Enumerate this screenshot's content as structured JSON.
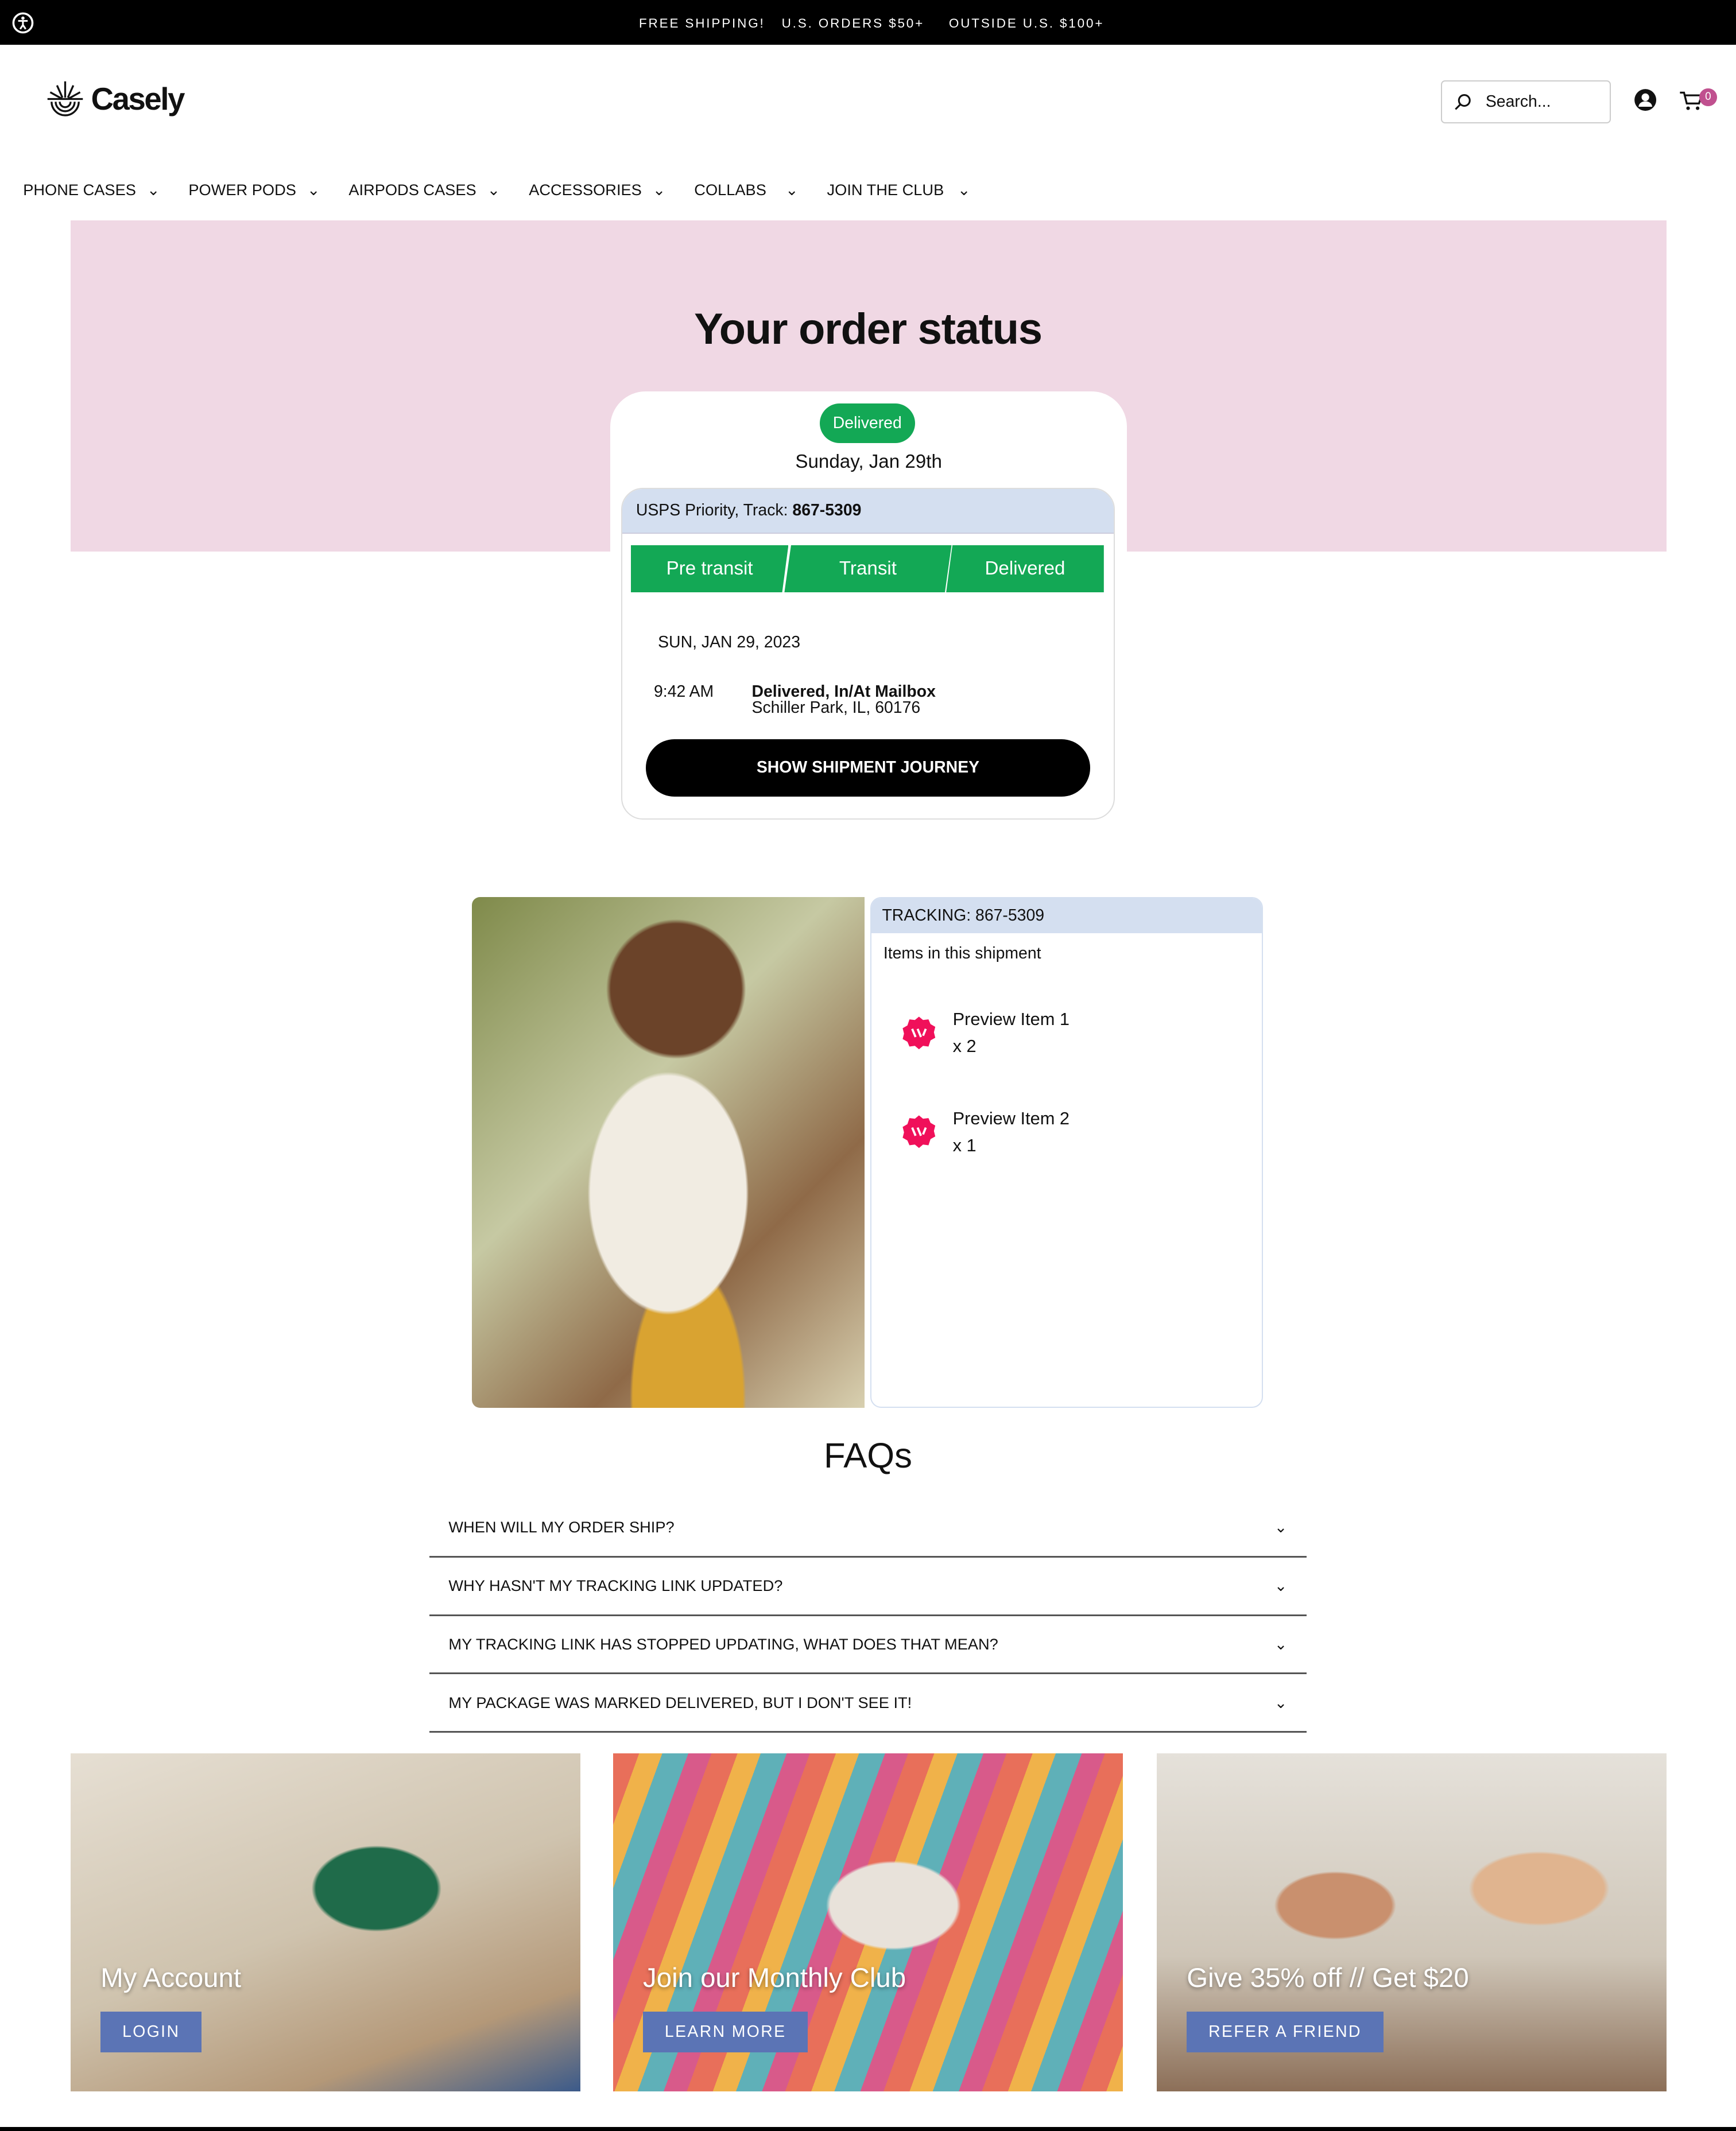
{
  "announcement": {
    "items": [
      "FREE SHIPPING!",
      "U.S. ORDERS $50+",
      "OUTSIDE U.S. $100+"
    ]
  },
  "header": {
    "brand": "Casely",
    "search_placeholder": "Search...",
    "cart_count": "0"
  },
  "nav": [
    {
      "label": "PHONE CASES"
    },
    {
      "label": "POWER PODS"
    },
    {
      "label": "AIRPODS CASES"
    },
    {
      "label": "ACCESSORIES"
    },
    {
      "label": "COLLABS"
    },
    {
      "label": "JOIN THE CLUB"
    }
  ],
  "order": {
    "title": "Your order status",
    "status": "Delivered",
    "date": "Sunday, Jan 29th",
    "carrier_label": "USPS Priority, Track: ",
    "tracking": "867-5309",
    "steps": [
      "Pre transit",
      "Transit",
      "Delivered"
    ],
    "event_date": "SUN, JAN 29, 2023",
    "event_time": "9:42 AM",
    "event_status": "Delivered, In/At Mailbox",
    "event_location": "Schiller Park, IL, 60176",
    "button": "SHOW SHIPMENT JOURNEY"
  },
  "shipment": {
    "header_label": "TRACKING: ",
    "tracking": "867-5309",
    "subtitle": "Items in this shipment",
    "items": [
      {
        "name": "Preview Item 1",
        "qty": "x 2"
      },
      {
        "name": "Preview Item 2",
        "qty": "x 1"
      }
    ]
  },
  "faq": {
    "title": "FAQs",
    "items": [
      "WHEN WILL MY ORDER SHIP?",
      "WHY HASN'T MY TRACKING LINK UPDATED?",
      "MY TRACKING LINK HAS STOPPED UPDATING, WHAT DOES THAT MEAN?",
      "MY PACKAGE WAS MARKED DELIVERED, BUT I DON'T SEE IT!"
    ]
  },
  "tiles": [
    {
      "title": "My Account",
      "button": "LOGIN"
    },
    {
      "title": "Join our Monthly Club",
      "button": "LEARN MORE"
    },
    {
      "title": "Give 35% off // Get $20",
      "button": "REFER A FRIEND"
    }
  ],
  "colors": {
    "green": "#13a855",
    "pink_banner": "#f0d8e4",
    "light_blue": "#d4dff0",
    "tile_button": "#5b74b5",
    "cart_badge": "#c0508f",
    "item_icon": "#f0105a"
  }
}
